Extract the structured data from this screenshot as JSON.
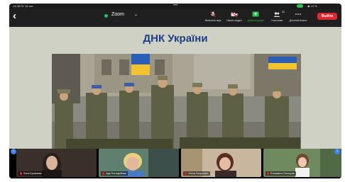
{
  "status": {
    "time": "14:28  Пт 14 окт.",
    "right": "◉ 10 %",
    "dots": "•••"
  },
  "header": {
    "back_icon": "chevron-left-icon",
    "app_title": "Zoom",
    "chevron": "⌄",
    "subtitle": "·····"
  },
  "toolbar": {
    "buttons": [
      {
        "name": "audio",
        "label": "Включить звук",
        "icon": "microphone-muted-icon"
      },
      {
        "name": "video",
        "label": "Начать видео",
        "icon": "camera-muted-icon"
      },
      {
        "name": "share",
        "label": "Демонстрация",
        "icon": "share-screen-icon"
      },
      {
        "name": "participants",
        "label": "Участники",
        "icon": "participants-icon",
        "count": "31"
      },
      {
        "name": "more",
        "label": "Дополнительно",
        "icon": "more-icon"
      }
    ],
    "leave_label": "Выйти",
    "leave_color": "#e0262f"
  },
  "slide": {
    "title": "ДНК України",
    "title_color": "#1f3f86"
  },
  "participants": [
    {
      "name": "Лиля Бровиева"
    },
    {
      "name": "Ида Погоцкийова"
    },
    {
      "name": "Ольга Скоркович"
    },
    {
      "name": "Елизавета Погоцкая"
    }
  ],
  "colors": {
    "accent_green": "#3bd36a",
    "ui_dark": "#1f1f1f"
  }
}
